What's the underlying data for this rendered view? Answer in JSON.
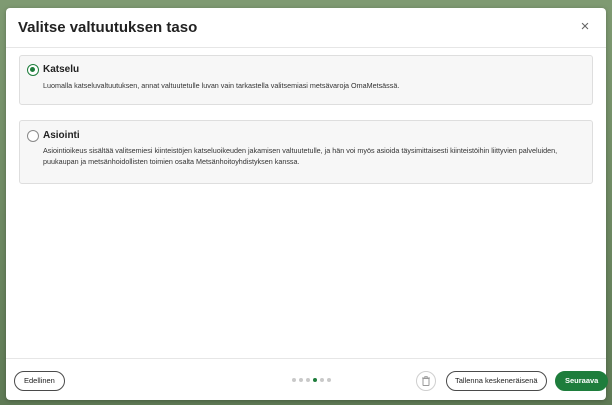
{
  "modal": {
    "title": "Valitse valtuutuksen taso",
    "close_symbol": "×"
  },
  "options": [
    {
      "title": "Katselu",
      "description": "Luomalla katseluvaltuutuksen, annat valtuutetulle luvan vain tarkastella valitsemiasi metsävaroja OmaMetsässä.",
      "selected": true
    },
    {
      "title": "Asiointi",
      "description": "Asiointioikeus sisältää valitsemiesi kiinteistöjen katseluoikeuden jakamisen valtuutetulle, ja hän voi myös asioida täysimittaisesti kiinteistöihin liittyvien palveluiden, puukaupan ja metsänhoidollisten toimien osalta Metsänhoitoyhdistyksen kanssa.",
      "selected": false
    }
  ],
  "footer": {
    "back_label": "Edellinen",
    "save_draft_label": "Tallenna keskeneräisenä",
    "next_label": "Seuraava",
    "steps_total": 6,
    "steps_current": 4
  },
  "colors": {
    "accent": "#1e7d3c",
    "backdrop": "#6f8a63"
  },
  "icons": {
    "close": "close-icon",
    "trash": "trash-icon",
    "radio_selected": "radio-checked-icon",
    "radio_unselected": "radio-unchecked-icon"
  }
}
